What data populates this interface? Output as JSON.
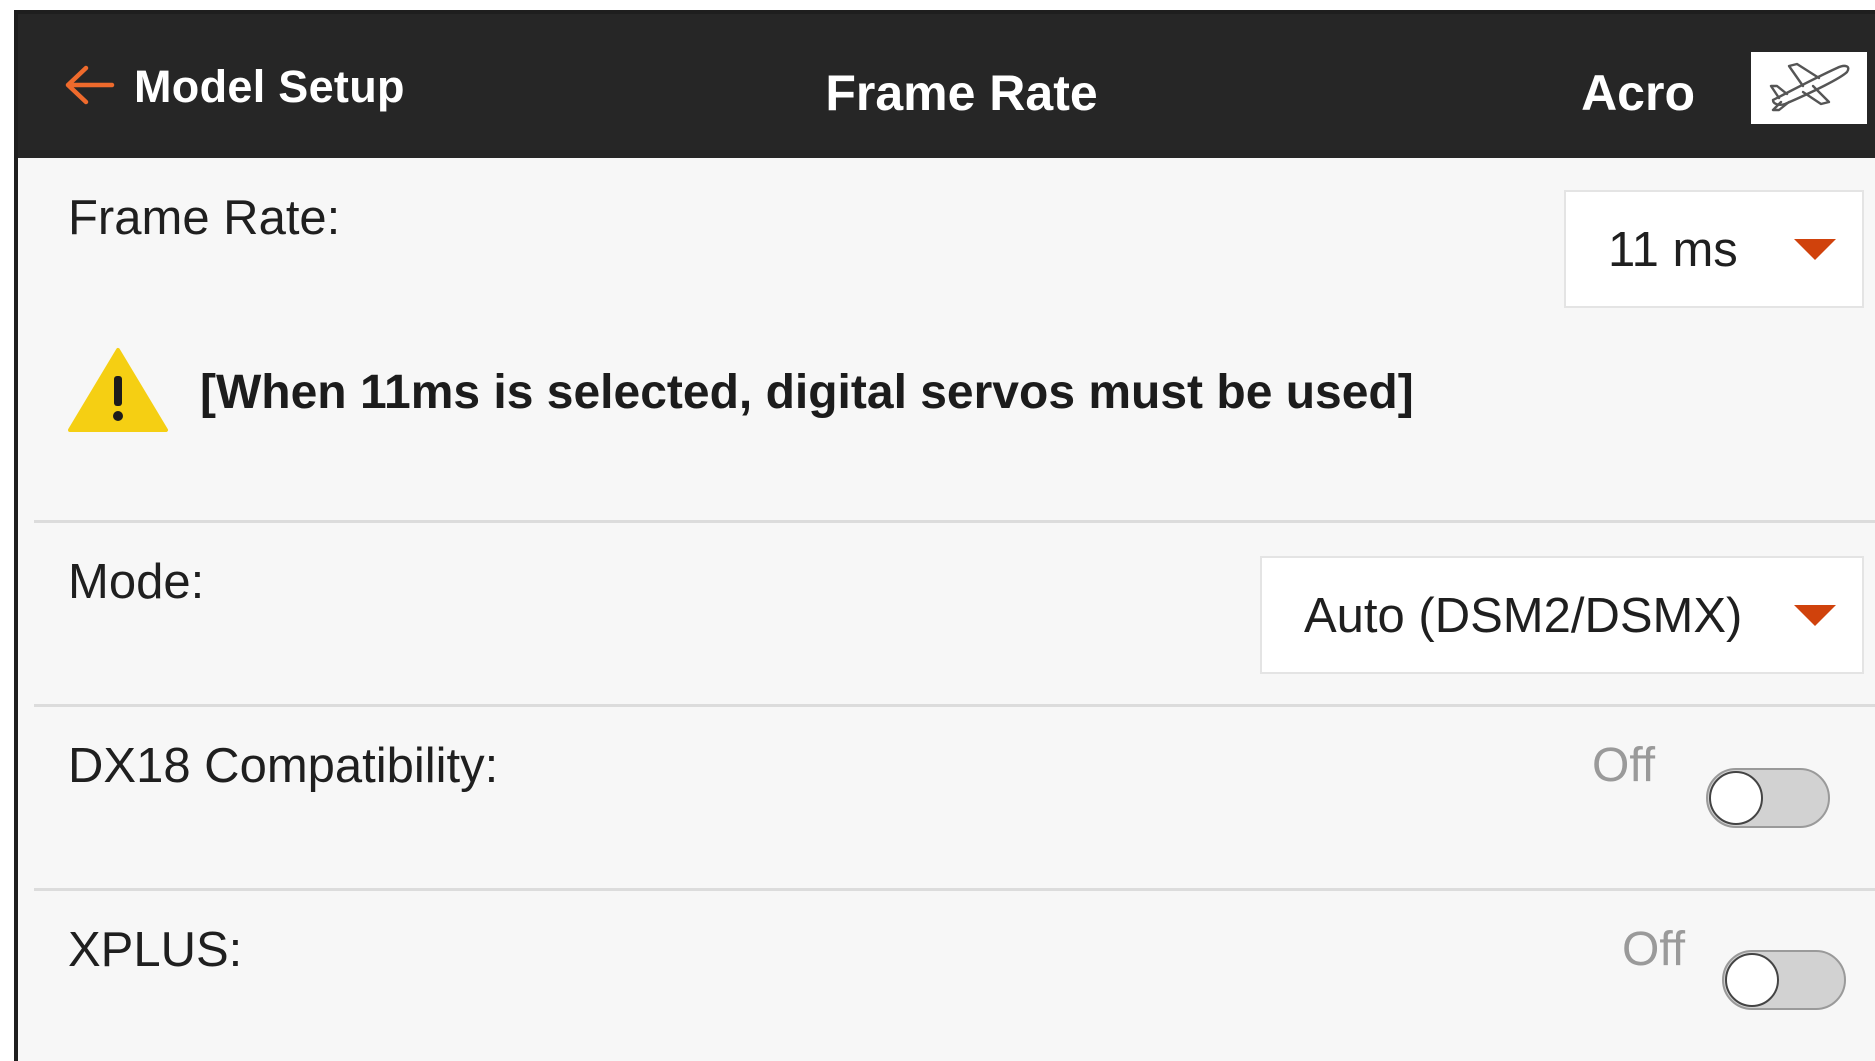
{
  "header": {
    "back_label": "Model Setup",
    "title": "Frame Rate",
    "model_name": "Acro",
    "back_icon": "arrow-left-icon",
    "model_icon": "airplane-icon"
  },
  "frame_rate": {
    "label": "Frame Rate:",
    "value": "11 ms"
  },
  "warning": {
    "icon": "warning-triangle-icon",
    "text": "[When 11ms is selected, digital servos must be used]"
  },
  "mode": {
    "label": "Mode:",
    "value": "Auto (DSM2/DSMX)"
  },
  "dx18": {
    "label": "DX18 Compatibility:",
    "status": "Off",
    "on": false
  },
  "xplus": {
    "label": "XPLUS:",
    "status": "Off",
    "on": false
  },
  "colors": {
    "header_bg": "#262626",
    "accent": "#d0420c",
    "warning_yellow": "#f5cf13"
  }
}
